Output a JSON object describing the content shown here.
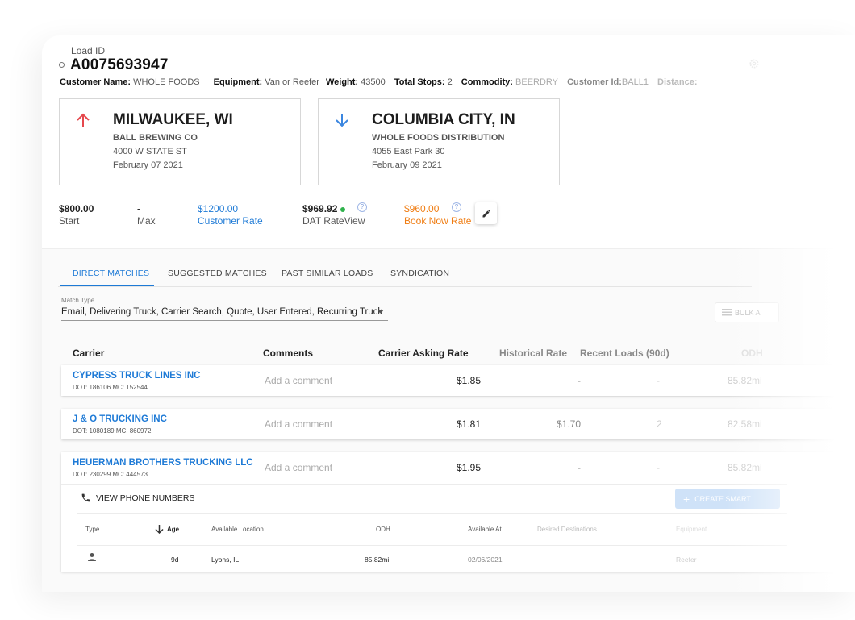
{
  "load": {
    "id_label": "Load ID",
    "id": "A0075693947"
  },
  "meta": {
    "customer_name_label": "Customer Name:",
    "customer_name": "WHOLE FOODS",
    "equipment_label": "Equipment:",
    "equipment": "Van or Reefer",
    "weight_label": "Weight:",
    "weight": "43500",
    "total_stops_label": "Total Stops:",
    "total_stops": "2",
    "commodity_label": "Commodity:",
    "commodity": "BEERDRY",
    "customer_id_label": "Customer Id:",
    "customer_id": "BALL1",
    "distance_label": "Distance:"
  },
  "origin": {
    "city": "MILWAUKEE, WI",
    "shipper": "BALL BREWING CO",
    "address": "4000 W STATE ST",
    "date": "February 07 2021"
  },
  "destination": {
    "city": "COLUMBIA CITY, IN",
    "shipper": "WHOLE FOODS DISTRIBUTION",
    "address": "4055 East Park 30",
    "date": "February 09 2021"
  },
  "rates": {
    "start_value": "$800.00",
    "start_label": "Start",
    "max_value": "-",
    "max_label": "Max",
    "customer_value": "$1200.00",
    "customer_label": "Customer Rate",
    "dat_value": "$969.92",
    "dat_label": "DAT RateView",
    "book_value": "$960.00",
    "book_label": "Book Now Rate",
    "help_glyph": "?"
  },
  "tabs": [
    {
      "label": "DIRECT MATCHES",
      "active": true
    },
    {
      "label": "SUGGESTED MATCHES",
      "active": false
    },
    {
      "label": "PAST SIMILAR LOADS",
      "active": false
    },
    {
      "label": "SYNDICATION",
      "active": false
    }
  ],
  "match_type": {
    "label": "Match Type",
    "value": "Email, Delivering Truck, Carrier Search, Quote, User Entered, Recurring Truck"
  },
  "bulk_button_label": "BULK A",
  "table": {
    "headers": {
      "carrier": "Carrier",
      "comments": "Comments",
      "asking": "Carrier Asking Rate",
      "historical": "Historical Rate",
      "recent": "Recent Loads (90d)",
      "odh": "ODH"
    },
    "rows": [
      {
        "name": "CYPRESS TRUCK LINES INC",
        "dot": "DOT: 186106 MC: 152544",
        "comment_placeholder": "Add a comment",
        "asking": "$1.85",
        "historical": "-",
        "recent": "-",
        "odh": "85.82mi"
      },
      {
        "name": "J & O TRUCKING INC",
        "dot": "DOT: 1080189 MC: 860972",
        "comment_placeholder": "Add a comment",
        "asking": "$1.81",
        "historical": "$1.70",
        "recent": "2",
        "odh": "82.58mi"
      },
      {
        "name": "HEUERMAN BROTHERS TRUCKING LLC",
        "dot": "DOT: 230299 MC: 444573",
        "comment_placeholder": "Add a comment",
        "asking": "$1.95",
        "historical": "-",
        "recent": "-",
        "odh": "85.82mi"
      }
    ]
  },
  "expanded": {
    "phone_label": "VIEW PHONE NUMBERS",
    "create_label": "CREATE SMART",
    "create_plus": "+",
    "headers": {
      "type": "Type",
      "age": "Age",
      "location": "Available Location",
      "odh": "ODH",
      "available_at": "Available At",
      "desired": "Desired Destinations",
      "equipment": "Equipment"
    },
    "row": {
      "age": "9d",
      "location": "Lyons, IL",
      "odh": "85.82mi",
      "available_at": "02/06/2021",
      "equipment": "Reefer"
    }
  },
  "colors": {
    "accent_blue": "#1e7ad6",
    "origin_arrow": "#e5484d",
    "dest_arrow": "#3b86e0",
    "book_orange": "#f07d13",
    "dat_green": "#2fb24c"
  },
  "icons": [
    "status-circle-icon",
    "gear-icon",
    "arrow-up-icon",
    "arrow-down-icon",
    "help-icon",
    "edit-pencil-icon",
    "dropdown-caret-icon",
    "list-icon",
    "phone-icon",
    "plus-icon",
    "sort-arrow-down-icon",
    "person-icon"
  ]
}
